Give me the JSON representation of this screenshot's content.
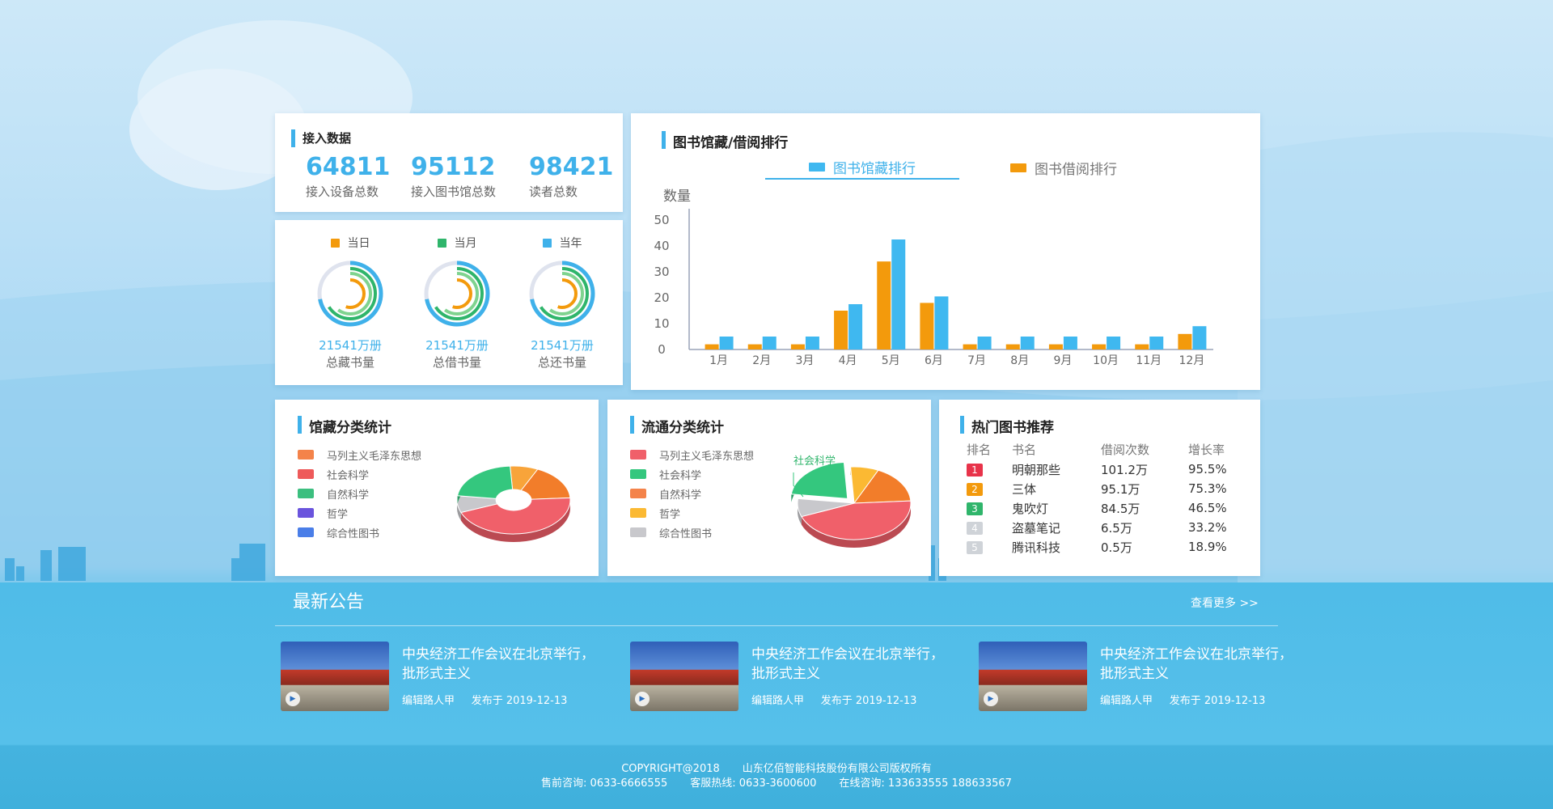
{
  "intake": {
    "title": "接入数据",
    "stats": [
      {
        "value": "64811",
        "label": "接入设备总数"
      },
      {
        "value": "95112",
        "label": "接入图书馆总数"
      },
      {
        "value": "98421",
        "label": "读者总数"
      }
    ]
  },
  "rings": {
    "legend": [
      {
        "label": "当日",
        "color": "#f39a0c"
      },
      {
        "label": "当月",
        "color": "#2fb56b"
      },
      {
        "label": "当年",
        "color": "#3fb1ea"
      }
    ],
    "items": [
      {
        "value": "21541万册",
        "label": "总藏书量"
      },
      {
        "value": "21541万册",
        "label": "总借书量"
      },
      {
        "value": "21541万册",
        "label": "总还书量"
      }
    ]
  },
  "ranking": {
    "title": "图书馆藏/借阅排行",
    "tabs": [
      "图书馆藏排行",
      "图书借阅排行"
    ],
    "active_tab": 0
  },
  "chart_data": [
    {
      "type": "bar",
      "ylabel": "数量",
      "categories": [
        "1月",
        "2月",
        "3月",
        "4月",
        "5月",
        "6月",
        "7月",
        "8月",
        "9月",
        "10月",
        "11月",
        "12月"
      ],
      "ylim": [
        0,
        50
      ],
      "yticks": [
        0,
        10,
        20,
        30,
        40,
        50
      ],
      "series": [
        {
          "name": "图书借阅排行",
          "color": "#f39a0c",
          "values": [
            2,
            2,
            2,
            15,
            34,
            18,
            2,
            2,
            2,
            2,
            2,
            6
          ]
        },
        {
          "name": "图书馆藏排行",
          "color": "#3fb8f0",
          "values": [
            5,
            5,
            5,
            17.5,
            42.5,
            20.5,
            5,
            5,
            5,
            5,
            5,
            9
          ]
        }
      ]
    },
    {
      "type": "pie",
      "title": "馆藏分类统计",
      "labels": [
        "马列主义毛泽东思想",
        "社会科学",
        "自然科学",
        "哲学",
        "综合性图书"
      ],
      "legend_colors": [
        "#f4834a",
        "#ee5a5a",
        "#3cbf7f",
        "#6a54dd",
        "#4a7ee8"
      ],
      "slice_colors": [
        "#f8a43a",
        "#f27d2a",
        "#f0606a",
        "#c8c8cc",
        "#34c77e"
      ],
      "values": [
        8,
        17,
        45,
        8,
        22
      ]
    },
    {
      "type": "pie",
      "title": "流通分类统计",
      "labels": [
        "马列主义毛泽东思想",
        "社会科学",
        "自然科学",
        "哲学",
        "综合性图书"
      ],
      "legend_colors": [
        "#f0606a",
        "#34c77e",
        "#f4834a",
        "#fbb933",
        "#c8c8cc"
      ],
      "slice_colors": [
        "#fbb933",
        "#f27d2a",
        "#f0606a",
        "#c8c8cc",
        "#34c77e"
      ],
      "values": [
        8,
        17,
        45,
        8,
        22
      ],
      "callout": "社会科学"
    }
  ],
  "hot": {
    "title": "热门图书推荐",
    "headers": [
      "排名",
      "书名",
      "借阅次数",
      "增长率"
    ],
    "rows": [
      {
        "rank": "1",
        "color": "#e8334a",
        "name": "明朝那些",
        "count": "101.2万",
        "rate": "95.5%"
      },
      {
        "rank": "2",
        "color": "#f39a0c",
        "name": "三体",
        "count": "95.1万",
        "rate": "75.3%"
      },
      {
        "rank": "3",
        "color": "#2fb56b",
        "name": "鬼吹灯",
        "count": "84.5万",
        "rate": "46.5%"
      },
      {
        "rank": "4",
        "color": "#cfd3d8",
        "name": "盗墓笔记",
        "count": "6.5万",
        "rate": "33.2%"
      },
      {
        "rank": "5",
        "color": "#cfd3d8",
        "name": "腾讯科技",
        "count": "0.5万",
        "rate": "18.9%"
      }
    ]
  },
  "news": {
    "title": "最新公告",
    "more": "查看更多 >>",
    "items": [
      {
        "title": "中央经济工作会议在北京举行，批形式主义",
        "editor": "编辑路人甲",
        "published": "发布于  2019-12-13"
      },
      {
        "title": "中央经济工作会议在北京举行，批形式主义",
        "editor": "编辑路人甲",
        "published": "发布于  2019-12-13"
      },
      {
        "title": "中央经济工作会议在北京举行，批形式主义",
        "editor": "编辑路人甲",
        "published": "发布于  2019-12-13"
      }
    ]
  },
  "footer": {
    "copyright": "COPYRIGHT@2018",
    "company": "山东亿佰智能科技股份有限公司版权所有",
    "presale": "售前咨询: 0633-6666555",
    "service": "客服热线: 0633-3600600",
    "online": "在线咨询: 133633555 188633567"
  }
}
